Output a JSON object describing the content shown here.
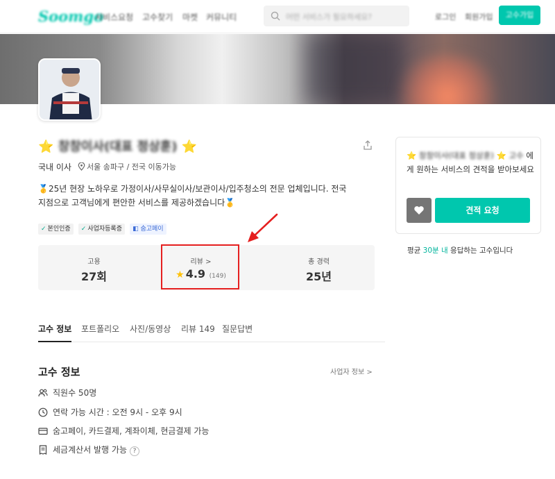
{
  "header": {
    "logo": "Soomgo",
    "nav": [
      "서비스요청",
      "고수찾기",
      "마켓",
      "커뮤니티"
    ],
    "search_placeholder": "어떤 서비스가 필요하세요?",
    "login": "로그인",
    "signup": "회원가입",
    "pro_signup": "고수가입"
  },
  "profile": {
    "name": "창창이사(대표 정상훈)",
    "category": "국내 이사",
    "location": "서울 송파구 / 전국 이동가능",
    "intro": "🥇25년 현장 노하우로 가정이사/사무실이사/보관이사/입주청소의 전문 업체입니다. 전국 지점으로 고객님에게 편안한 서비스를 제공하겠습니다🥇",
    "badges": [
      "본인인증",
      "사업자등록증",
      "숨고페이"
    ]
  },
  "stats": {
    "hire_label": "고용",
    "hire_value": "27회",
    "review_label": "리뷰 >",
    "review_rating": "4.9",
    "review_count": "(149)",
    "career_label": "총 경력",
    "career_value": "25년"
  },
  "tabs": [
    "고수 정보",
    "포트폴리오",
    "사진/동영상",
    "리뷰 149",
    "질문답변"
  ],
  "info": {
    "title": "고수 정보",
    "business_link": "사업자 정보 >",
    "employees": "직원수 50명",
    "hours": "연락 가능 시간 : 오전 9시 - 오후 9시",
    "payment": "숨고페이, 카드결제, 계좌이체, 현금결제 가능",
    "tax": "세금계산서 발행 가능",
    "tax_help": "?"
  },
  "sidebar": {
    "message_name": "창창이사(대표 정상훈)",
    "message_suffix": "고수",
    "message_rest": "에게 원하는 서비스의 견적을 받아보세요",
    "quote_button": "견적 요청",
    "response_prefix": "평균",
    "response_time": "30분 내",
    "response_suffix": "응답하는 고수입니다"
  },
  "colors": {
    "brand": "#00c7ae",
    "highlight_box": "#e51f1f",
    "star": "#ffc107"
  }
}
